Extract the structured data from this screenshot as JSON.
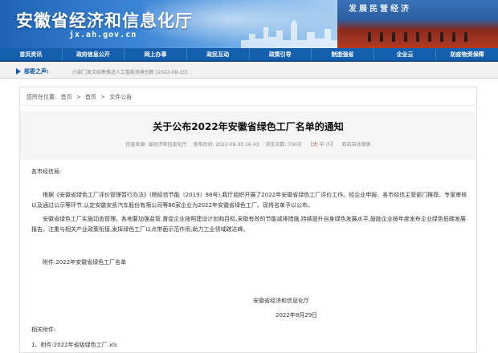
{
  "header": {
    "site_title": "安徽省经济和信息化厅",
    "site_domain": "jx.ah.gov.cn",
    "banner_slogan": "发展民营经济",
    "colors": {
      "brand_blue": "#1f63b5",
      "nav_blue": "#145fae",
      "stage_red": "#b33a22"
    }
  },
  "nav": {
    "items": [
      {
        "label": "首页资讯"
      },
      {
        "label": "政府信息公开"
      },
      {
        "label": "网上办事"
      },
      {
        "label": "政民互动"
      },
      {
        "label": "政策引导"
      },
      {
        "label": "制造强省"
      },
      {
        "label": "企业云"
      },
      {
        "label": "防疫物资保障"
      }
    ]
  },
  "ticker": {
    "label": "部委之声:",
    "news": "六部门发文统筹推进人工智能场景创新 [2022-08-15]"
  },
  "breadcrumb": {
    "prefix": "您所在位置:",
    "items": [
      "首页",
      "首页",
      "文件公告"
    ],
    "separator": ">"
  },
  "article": {
    "title": "关于公布2022年安徽省绿色工厂名单的通知",
    "meta": {
      "source_label": "信息来源:",
      "source": "省经济和信息化厅",
      "date_label": "发布时间:",
      "date": "2022-08-30 16:43",
      "views_label": "浏览次数:",
      "views": "700次",
      "font_open": "【",
      "font_large": "大",
      "font_medium": "中",
      "font_small": "小",
      "font_close": "】",
      "auto_scroll": "双击自动滚屏"
    },
    "salutation": "各市经信局:",
    "paragraph1": "根据《安徽省绿色工厂评价管理暂行办法》(皖经信节能〔2019〕98号),我厅组织开展了2022年安徽省绿色工厂评价工作。经企业申报、各市经信主管部门推荐、专家审核以及通过公示等环节,认定安徽安凯汽车股份有限公司等86家企业为2022年安徽省绿色工厂。现将名单予以公布。",
    "paragraph2": "安徽省绿色工厂实施动态管理。各地要加强监管,督促企业按照建设计划和目标,采取有效的节能减排措施,持续提升自身绿色发展水平,鼓励企业按年度发布企业绿色低碳发展报告。注重与相关产业政策衔接,发挥绿色工厂以点带面示范作用,助力工业领域碳达峰。",
    "attachment_line": "附件:2022年安徽省绿色工厂名单",
    "signer": "安徽省经济和信息化厅",
    "sign_date": "2022年8月29日",
    "related_label": "相关附件:",
    "files": [
      {
        "label": "1、附件:2022年省级绿色工厂.xls"
      }
    ]
  }
}
